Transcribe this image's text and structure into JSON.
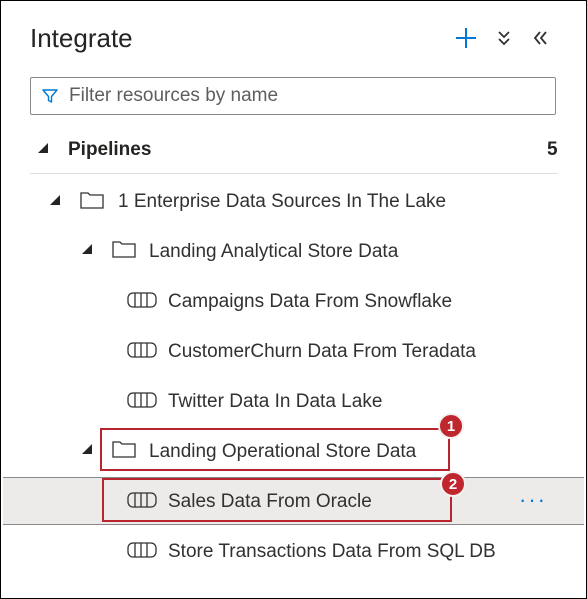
{
  "header": {
    "title": "Integrate"
  },
  "toolbar": {
    "add_icon": "plus-icon",
    "expand_icon": "double-chevron-down-icon",
    "collapse_icon": "double-chevron-left-icon"
  },
  "filter": {
    "placeholder": "Filter resources by name",
    "value": ""
  },
  "pipelines": {
    "label": "Pipelines",
    "count": "5",
    "folder": {
      "name": "1 Enterprise Data Sources In The Lake",
      "subfolders": [
        {
          "name": "Landing Analytical Store Data",
          "items": [
            "Campaigns Data From Snowflake",
            "CustomerChurn Data From Teradata",
            "Twitter Data In Data Lake"
          ]
        },
        {
          "name": "Landing Operational Store Data",
          "items": [
            "Sales Data From Oracle",
            "Store Transactions Data From SQL DB"
          ]
        }
      ]
    }
  },
  "callouts": [
    "1",
    "2"
  ],
  "more_label": "···",
  "colors": {
    "accent": "#0078d4",
    "callout": "#c0262d",
    "selected": "#edebe9"
  }
}
